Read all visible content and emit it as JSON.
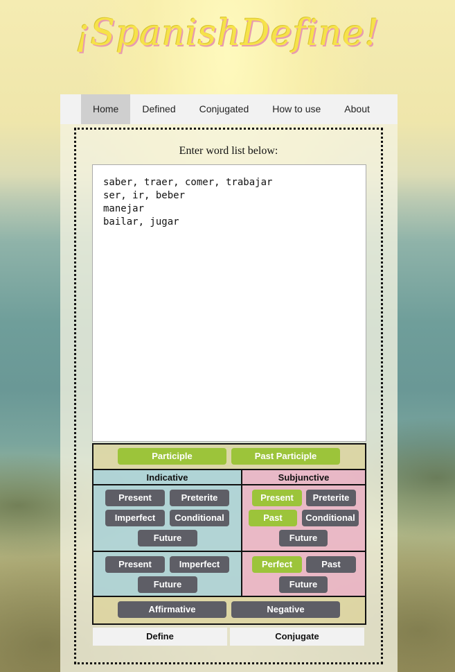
{
  "logo": "¡SpanishDefine!",
  "nav": {
    "items": [
      "Home",
      "Defined",
      "Conjugated",
      "How to use",
      "About"
    ]
  },
  "prompt": "Enter word list below:",
  "word_list": "saber, traer, comer, trabajar\nser, ir, beber\nmanejar\nbailar, jugar",
  "participle": {
    "participle": "Participle",
    "past_participle": "Past Participle"
  },
  "headers": {
    "indicative": "Indicative",
    "subjunctive": "Subjunctive"
  },
  "indicative": {
    "present": "Present",
    "preterite": "Preterite",
    "imperfect": "Imperfect",
    "conditional": "Conditional",
    "future": "Future"
  },
  "subjunctive": {
    "present": "Present",
    "preterite": "Preterite",
    "past": "Past",
    "conditional": "Conditional",
    "future": "Future"
  },
  "ind_secondary": {
    "present": "Present",
    "imperfect": "Imperfect",
    "future": "Future"
  },
  "subj_secondary": {
    "perfect": "Perfect",
    "past": "Past",
    "future": "Future"
  },
  "imperative": {
    "affirmative": "Affirmative",
    "negative": "Negative"
  },
  "actions": {
    "define": "Define",
    "conjugate": "Conjugate"
  },
  "colors": {
    "selected": "#9cc43a",
    "unselected": "#5e5e66",
    "indicative_bg": "#a0cdd7",
    "subjunctive_bg": "#ebaac3",
    "logo": "#f6e24a"
  }
}
